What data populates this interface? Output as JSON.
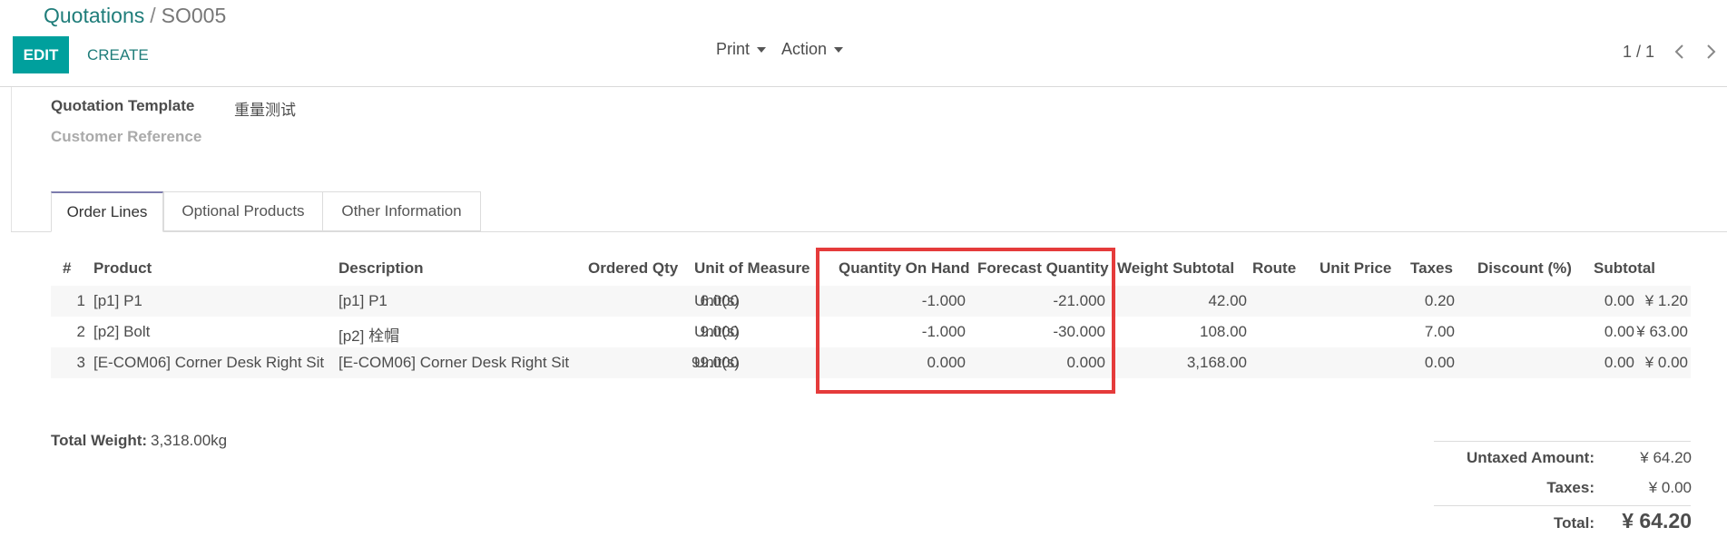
{
  "breadcrumb": {
    "parent": "Quotations",
    "separator": "/",
    "current": "SO005"
  },
  "toolbar": {
    "edit_label": "EDIT",
    "create_label": "CREATE",
    "print_label": "Print",
    "action_label": "Action"
  },
  "pager": {
    "text": "1 / 1"
  },
  "fields": {
    "quotation_template_label": "Quotation Template",
    "quotation_template_value": "重量测试",
    "customer_reference_label": "Customer Reference"
  },
  "tabs": [
    {
      "label": "Order Lines",
      "active": true
    },
    {
      "label": "Optional Products",
      "active": false
    },
    {
      "label": "Other Information",
      "active": false
    }
  ],
  "table": {
    "headers": [
      "#",
      "Product",
      "Description",
      "Ordered Qty",
      "Unit of Measure",
      "Quantity On Hand",
      "Forecast Quantity",
      "Weight Subtotal",
      "Route",
      "Unit Price",
      "Taxes",
      "Discount (%)",
      "Subtotal"
    ],
    "rows": [
      {
        "num": "1",
        "product": "[p1] P1",
        "description": "[p1] P1",
        "ordered_qty": "6.000",
        "uom": "Unit(s)",
        "qty_on_hand": "-1.000",
        "forecast_qty": "-21.000",
        "weight_subtotal": "42.00",
        "route": "",
        "unit_price": "0.20",
        "taxes": "",
        "discount": "0.00",
        "subtotal": "¥ 1.20"
      },
      {
        "num": "2",
        "product": "[p2] Bolt",
        "description": "[p2] 栓帽",
        "ordered_qty": "9.000",
        "uom": "Unit(s)",
        "qty_on_hand": "-1.000",
        "forecast_qty": "-30.000",
        "weight_subtotal": "108.00",
        "route": "",
        "unit_price": "7.00",
        "taxes": "",
        "discount": "0.00",
        "subtotal": "¥ 63.00"
      },
      {
        "num": "3",
        "product": "[E-COM06] Corner Desk Right Sit",
        "description": "[E-COM06] Corner Desk Right Sit",
        "ordered_qty": "99.000",
        "uom": "Unit(s)",
        "qty_on_hand": "0.000",
        "forecast_qty": "0.000",
        "weight_subtotal": "3,168.00",
        "route": "",
        "unit_price": "0.00",
        "taxes": "",
        "discount": "0.00",
        "subtotal": "¥ 0.00"
      }
    ]
  },
  "total_weight": {
    "label": "Total Weight:",
    "value": "3,318.00kg"
  },
  "totals": {
    "untaxed_label": "Untaxed Amount:",
    "untaxed_value": "¥ 64.20",
    "taxes_label": "Taxes:",
    "taxes_value": "¥ 0.00",
    "total_label": "Total:",
    "total_value": "¥ 64.20"
  },
  "colors": {
    "primary": "#00a09d",
    "link": "#1f7d7a",
    "highlight": "#e53b3b",
    "tab_accent": "#7c7bad"
  }
}
